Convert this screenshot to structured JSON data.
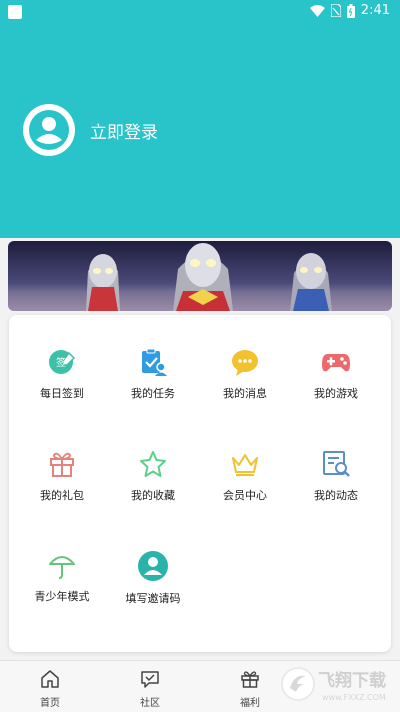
{
  "status_bar": {
    "time": "2:41"
  },
  "header": {
    "login_text": "立即登录"
  },
  "menu": [
    {
      "label": "每日签到",
      "icon": "sign-in-icon",
      "color": "#3cc1a8"
    },
    {
      "label": "我的任务",
      "icon": "task-icon",
      "color": "#2f9be0"
    },
    {
      "label": "我的消息",
      "icon": "message-icon",
      "color": "#f2c12e"
    },
    {
      "label": "我的游戏",
      "icon": "gamepad-icon",
      "color": "#ee6a6a"
    },
    {
      "label": "我的礼包",
      "icon": "gift-icon",
      "color": "#e2847c"
    },
    {
      "label": "我的收藏",
      "icon": "star-icon",
      "color": "#5ccf8b"
    },
    {
      "label": "会员中心",
      "icon": "crown-icon",
      "color": "#f2c12e"
    },
    {
      "label": "我的动态",
      "icon": "news-icon",
      "color": "#5b8fc8"
    },
    {
      "label": "青少年模式",
      "icon": "umbrella-icon",
      "color": "#66c37a"
    },
    {
      "label": "填写邀请码",
      "icon": "invite-icon",
      "color": "#2ab3a8"
    }
  ],
  "tabbar": {
    "items": [
      {
        "label": "首页",
        "icon": "home-icon"
      },
      {
        "label": "社区",
        "icon": "community-icon"
      },
      {
        "label": "福利",
        "icon": "gift-icon"
      }
    ]
  },
  "watermark": {
    "text": "飞翔下载",
    "subtext": "www.FXXZ.COM"
  },
  "colors": {
    "header_bg": "#28c4c9",
    "card_bg": "#ffffff",
    "page_bg": "#f2f2f2"
  }
}
